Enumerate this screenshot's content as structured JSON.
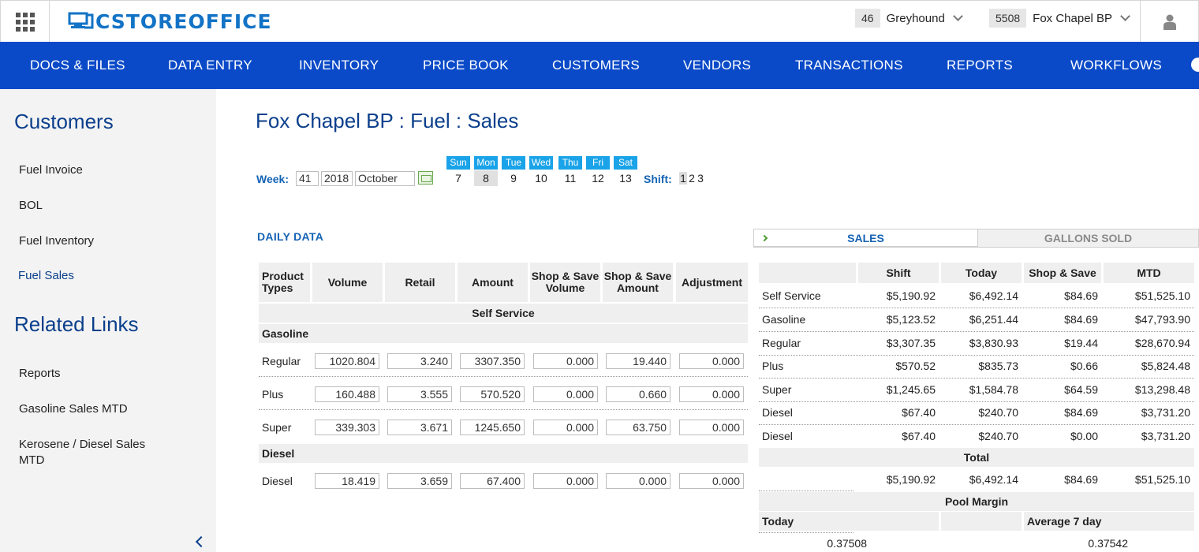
{
  "header": {
    "logo_text": "CSTOREOFFICE",
    "store_selector_1": {
      "number": "46",
      "name": "Greyhound"
    },
    "store_selector_2": {
      "number": "5508",
      "name": "Fox Chapel BP"
    }
  },
  "nav": {
    "items": [
      "DOCS & FILES",
      "DATA ENTRY",
      "INVENTORY",
      "PRICE BOOK",
      "CUSTOMERS",
      "VENDORS",
      "TRANSACTIONS",
      "REPORTS",
      "WORKFLOWS"
    ]
  },
  "sidebar": {
    "heading": "Customers",
    "links": [
      "Fuel Invoice",
      "BOL",
      "Fuel Inventory",
      "Fuel Sales"
    ],
    "active_link": "Fuel Sales",
    "related_heading": "Related Links",
    "related_links": [
      "Reports",
      "Gasoline Sales MTD",
      "Kerosene / Diesel Sales MTD"
    ]
  },
  "page": {
    "title": "Fox Chapel BP : Fuel : Sales",
    "week_label": "Week:",
    "week_number": "41",
    "year": "2018",
    "month": "October",
    "days": [
      {
        "name": "Sun",
        "date": "7"
      },
      {
        "name": "Mon",
        "date": "8"
      },
      {
        "name": "Tue",
        "date": "9"
      },
      {
        "name": "Wed",
        "date": "10"
      },
      {
        "name": "Thu",
        "date": "11"
      },
      {
        "name": "Fri",
        "date": "12"
      },
      {
        "name": "Sat",
        "date": "13"
      }
    ],
    "selected_day": "Mon",
    "shift_label": "Shift:",
    "shifts": [
      "1",
      "2",
      "3"
    ],
    "selected_shift": "1"
  },
  "daily_data": {
    "title": "DAILY DATA",
    "columns": [
      "Product Types",
      "Volume",
      "Retail",
      "Amount",
      "Shop & Save Volume",
      "Shop & Save Amount",
      "Adjustment"
    ],
    "section": "Self Service",
    "groups": [
      {
        "name": "Gasoline",
        "rows": [
          {
            "product": "Regular",
            "values": [
              "1020.804",
              "3.240",
              "3307.350",
              "0.000",
              "19.440",
              "0.000"
            ]
          },
          {
            "product": "Plus",
            "values": [
              "160.488",
              "3.555",
              "570.520",
              "0.000",
              "0.660",
              "0.000"
            ]
          },
          {
            "product": "Super",
            "values": [
              "339.303",
              "3.671",
              "1245.650",
              "0.000",
              "63.750",
              "0.000"
            ]
          }
        ]
      },
      {
        "name": "Diesel",
        "rows": [
          {
            "product": "Diesel",
            "values": [
              "18.419",
              "3.659",
              "67.400",
              "0.000",
              "0.000",
              "0.000"
            ]
          }
        ]
      }
    ]
  },
  "summary": {
    "tabs": [
      "SALES",
      "GALLONS SOLD"
    ],
    "active_tab": "SALES",
    "columns": [
      "Shift",
      "Today",
      "Shop & Save",
      "MTD"
    ],
    "rows": [
      {
        "label": "Self Service",
        "values": [
          "$5,190.92",
          "$6,492.14",
          "$84.69",
          "$51,525.10"
        ]
      },
      {
        "label": "Gasoline",
        "values": [
          "$5,123.52",
          "$6,251.44",
          "$84.69",
          "$47,793.90"
        ]
      },
      {
        "label": "Regular",
        "values": [
          "$3,307.35",
          "$3,830.93",
          "$19.44",
          "$28,670.94"
        ]
      },
      {
        "label": "Plus",
        "values": [
          "$570.52",
          "$835.73",
          "$0.66",
          "$5,824.48"
        ]
      },
      {
        "label": "Super",
        "values": [
          "$1,245.65",
          "$1,584.78",
          "$64.59",
          "$13,298.48"
        ]
      },
      {
        "label": "Diesel",
        "values": [
          "$67.40",
          "$240.70",
          "$84.69",
          "$3,731.20"
        ]
      },
      {
        "label": "Diesel",
        "values": [
          "$67.40",
          "$240.70",
          "$0.00",
          "$3,731.20"
        ]
      }
    ],
    "total_label": "Total",
    "total_values": [
      "$5,190.92",
      "$6,492.14",
      "$84.69",
      "$51,525.10"
    ],
    "pool_margin_label": "Pool Margin",
    "pool_today_label": "Today",
    "pool_avg_label": "Average 7 day",
    "pool_today_value": "0.37508",
    "pool_avg_value": "0.37542"
  }
}
